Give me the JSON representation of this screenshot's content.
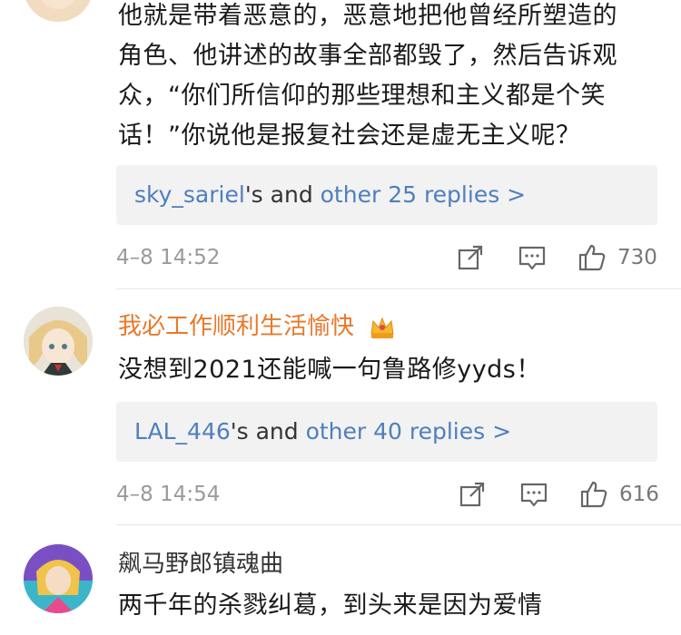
{
  "comments": [
    {
      "text_lines": [
        "他就是带着恶意的，恶意地把他曾经所塑造的",
        "角色、他讲述的故事全部都毁了，然后告诉观",
        "众，“你们所信仰的那些理想和主义都是个笑",
        "话！”你说他是报复社会还是虚无主义呢？"
      ],
      "replies": {
        "user": "sky_sariel",
        "mid": "'s and ",
        "more": "other 25 replies >"
      },
      "timestamp": "4–8 14:52",
      "likes": "730"
    },
    {
      "username": "我必工作顺利生活愉快",
      "username_color": "#e8792b",
      "text": "没想到2021还能喊一句鲁路修yyds！",
      "replies": {
        "user": "LAL_446",
        "mid": "'s and ",
        "more": "other 40 replies >"
      },
      "timestamp": "4–8 14:54",
      "likes": "616"
    },
    {
      "username": "飙马野郎镇魂曲",
      "username_color": "#333333",
      "text": "两千年的杀戮纠葛，到头来是因为爱情"
    }
  ],
  "icons": {
    "share": "share-icon",
    "comment": "comment-icon",
    "like": "thumbs-up-icon",
    "vip": "crown-badge-icon"
  }
}
